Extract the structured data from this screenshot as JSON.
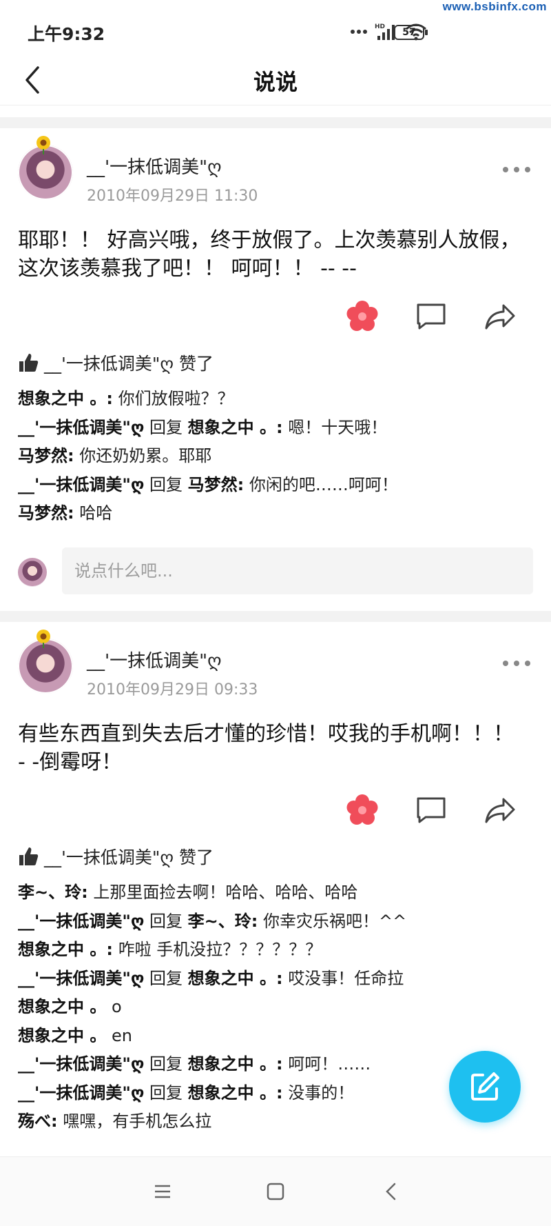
{
  "watermark": "www.bsbinfx.com",
  "status": {
    "time": "上午9:32",
    "battery": "57",
    "network": "HD"
  },
  "header": {
    "title": "说说",
    "back_icon": "chevron-left-icon"
  },
  "colors": {
    "accent": "#1ec0f0",
    "like_flower": "#f04d5a",
    "secondary_text": "#9a9a9a"
  },
  "posts": [
    {
      "author": "__'一抹低调美\"ღ",
      "time": "2010年09月29日 11:30",
      "text": "耶耶！！ 好高兴哦，终于放假了。上次羡慕别人放假，这次该羡慕我了吧！！ 呵呵！！ -- --",
      "likes": "__'一抹低调美\"ღ 赞了",
      "comments": [
        {
          "name": "想象之中 。:",
          "text": " 你们放假啦？？"
        },
        {
          "name": "__'一抹低调美\"ღ",
          "reply_word": " 回复 ",
          "reply_to": "想象之中 。:",
          "text": " 嗯！十天哦！"
        },
        {
          "name": "马梦然:",
          "text": " 你还奶奶累。耶耶"
        },
        {
          "name": "__'一抹低调美\"ღ",
          "reply_word": " 回复 ",
          "reply_to": "马梦然:",
          "text": " 你闲的吧……呵呵！"
        },
        {
          "name": "马梦然:",
          "text": " 哈哈"
        }
      ],
      "input_placeholder": "说点什么吧..."
    },
    {
      "author": "__'一抹低调美\"ღ",
      "time": "2010年09月29日 09:33",
      "text": "有些东西直到失去后才懂的珍惜！哎我的手机啊！！！ - -倒霉呀！",
      "likes": "__'一抹低调美\"ღ 赞了",
      "comments": [
        {
          "name": "李~、玲:",
          "text": " 上那里面捡去啊！哈哈、哈哈、哈哈"
        },
        {
          "name": "__'一抹低调美\"ღ",
          "reply_word": " 回复 ",
          "reply_to": "李~、玲:",
          "text": " 你幸灾乐祸吧！^^"
        },
        {
          "name": "想象之中 。:",
          "text": " 咋啦 手机没拉？？？？？？"
        },
        {
          "name": "__'一抹低调美\"ღ",
          "reply_word": " 回复 ",
          "reply_to": "想象之中 。:",
          "text": " 哎没事！任命拉"
        },
        {
          "name": "想象之中 。",
          "text": "o"
        },
        {
          "name": "想象之中 。",
          "text": "en"
        },
        {
          "name": "__'一抹低调美\"ღ",
          "reply_word": " 回复 ",
          "reply_to": "想象之中 。:",
          "text": " 呵呵！……"
        },
        {
          "name": "__'一抹低调美\"ღ",
          "reply_word": " 回复 ",
          "reply_to": "想象之中 。:",
          "text": " 没事的！"
        },
        {
          "name": "殇べ:",
          "text": " 嘿嘿，有手机怎么拉"
        }
      ]
    }
  ],
  "nav": {
    "menu_icon": "menu-icon",
    "home_icon": "home-square-icon",
    "back_icon": "back-triangle-icon"
  },
  "fab_icon": "edit-icon"
}
